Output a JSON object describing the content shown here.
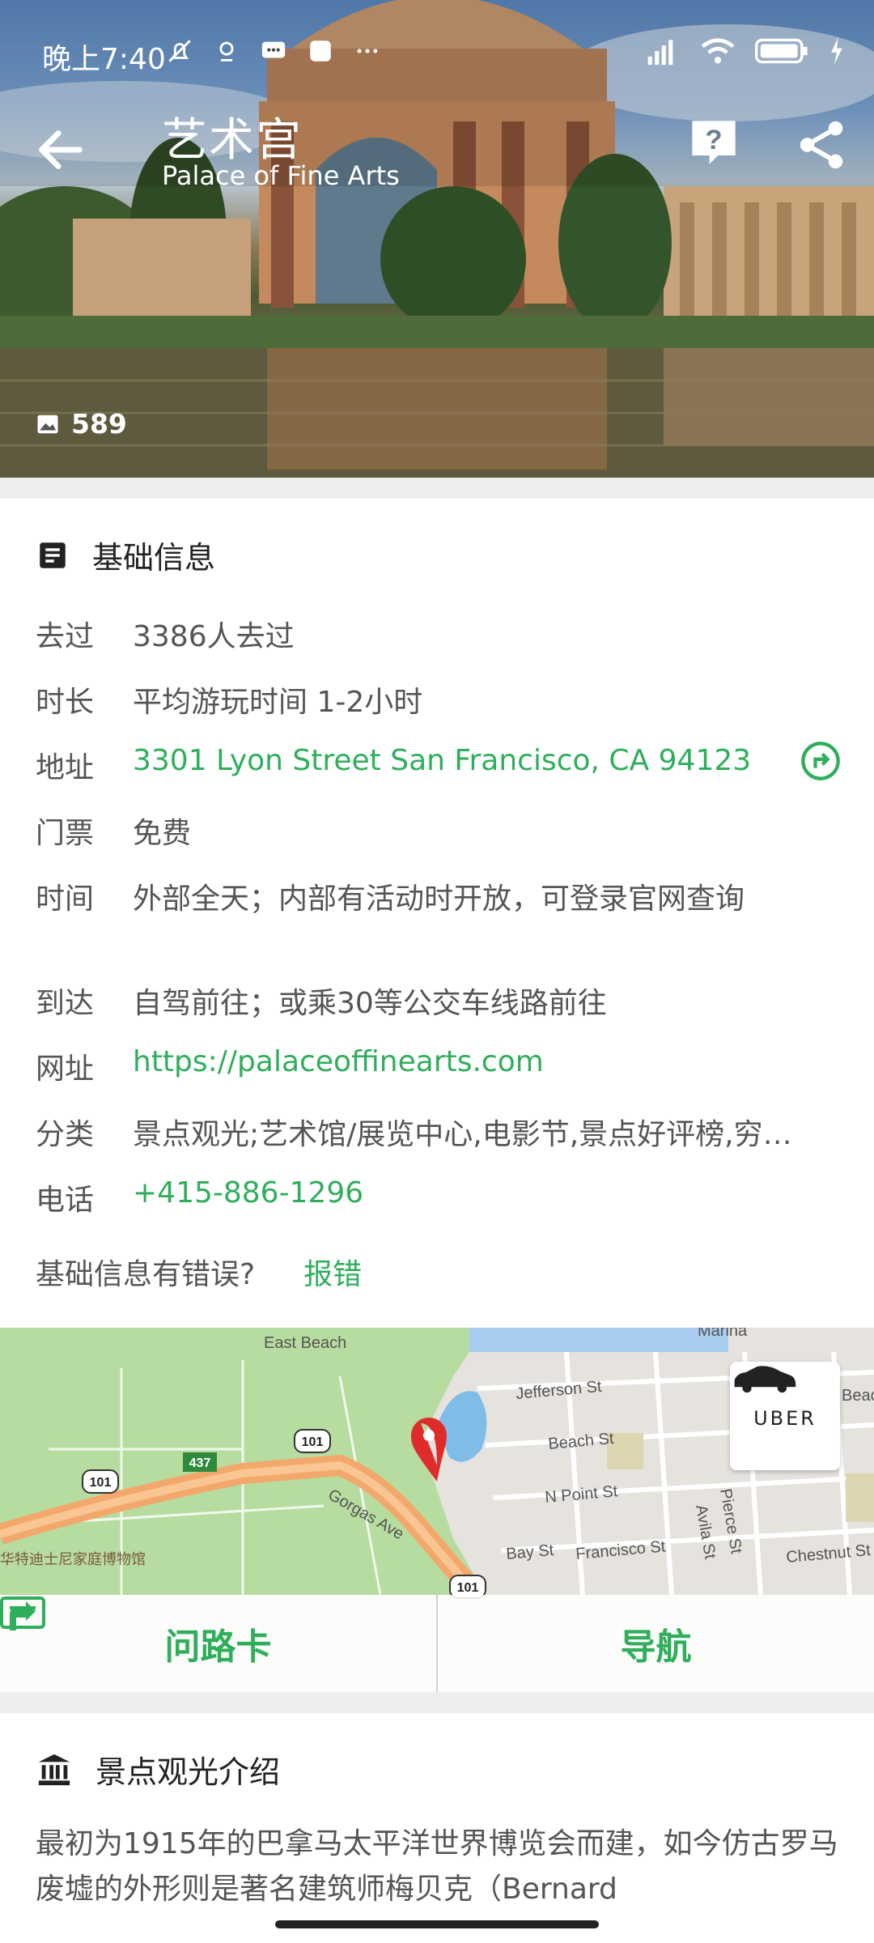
{
  "status_bar": {
    "time": "晚上7:40"
  },
  "header": {
    "title_zh": "艺术宫",
    "title_en": "Palace of Fine Arts",
    "photo_count": "589"
  },
  "basic_info": {
    "section_title": "基础信息",
    "rows": [
      {
        "key": "去过",
        "value": "3386人去过",
        "style": "plain"
      },
      {
        "key": "时长",
        "value": "平均游玩时间 1-2小时",
        "style": "plain"
      },
      {
        "key": "地址",
        "value": "3301 Lyon Street San Francisco, CA 94123",
        "style": "link"
      },
      {
        "key": "门票",
        "value": "免费",
        "style": "plain"
      },
      {
        "key": "时间",
        "value": "外部全天；内部有活动时开放，可登录官网查询",
        "style": "plain"
      },
      {
        "key": "到达",
        "value": "自驾前往；或乘30等公交车线路前往",
        "style": "plain"
      },
      {
        "key": "网址",
        "value": "https://palaceoffinearts.com",
        "style": "link"
      },
      {
        "key": "分类",
        "value": "景点观光;艺术馆/展览中心,电影节,景点好评榜,穷…",
        "style": "plain"
      },
      {
        "key": "电话",
        "value": "+415-886-1296",
        "style": "link"
      }
    ],
    "report_prompt": "基础信息有错误?",
    "report_link": "报错"
  },
  "map": {
    "labels": {
      "east_beach": "East Beach",
      "marina": "Marina",
      "jefferson": "Jefferson St",
      "beach_st": "Beach St",
      "n_point": "N Point St",
      "bay_st": "Bay St",
      "francisco": "Francisco St",
      "chestnut": "Chestnut St",
      "gorgas": "Gorgas Ave",
      "avila": "Avila St",
      "pierce": "Pierce St",
      "museum": "华特迪士尼家庭博物馆",
      "route_101a": "101",
      "route_101b": "101",
      "route_101c": "101",
      "route_437": "437",
      "beach_edge": "Beac"
    },
    "uber_label": "UBER",
    "ask_card_label": "问路卡",
    "navigate_label": "导航"
  },
  "intro": {
    "section_title": "景点观光介绍",
    "text": "最初为1915年的巴拿马太平洋世界博览会而建，如今仿古罗马废墟的外形则是著名建筑师梅贝克（Bernard"
  },
  "colors": {
    "accent_green": "#2fae5b",
    "text_gray": "#555555"
  }
}
